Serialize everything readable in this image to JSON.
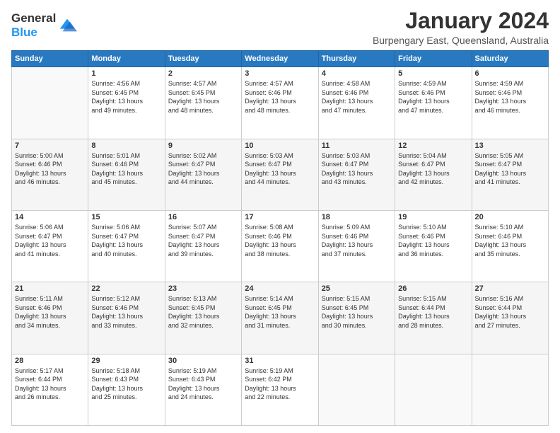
{
  "header": {
    "logo_general": "General",
    "logo_blue": "Blue",
    "month": "January 2024",
    "location": "Burpengary East, Queensland, Australia"
  },
  "weekdays": [
    "Sunday",
    "Monday",
    "Tuesday",
    "Wednesday",
    "Thursday",
    "Friday",
    "Saturday"
  ],
  "weeks": [
    [
      {
        "day": "",
        "sunrise": "",
        "sunset": "",
        "daylight": ""
      },
      {
        "day": "1",
        "sunrise": "Sunrise: 4:56 AM",
        "sunset": "Sunset: 6:45 PM",
        "daylight": "Daylight: 13 hours and 49 minutes."
      },
      {
        "day": "2",
        "sunrise": "Sunrise: 4:57 AM",
        "sunset": "Sunset: 6:45 PM",
        "daylight": "Daylight: 13 hours and 48 minutes."
      },
      {
        "day": "3",
        "sunrise": "Sunrise: 4:57 AM",
        "sunset": "Sunset: 6:46 PM",
        "daylight": "Daylight: 13 hours and 48 minutes."
      },
      {
        "day": "4",
        "sunrise": "Sunrise: 4:58 AM",
        "sunset": "Sunset: 6:46 PM",
        "daylight": "Daylight: 13 hours and 47 minutes."
      },
      {
        "day": "5",
        "sunrise": "Sunrise: 4:59 AM",
        "sunset": "Sunset: 6:46 PM",
        "daylight": "Daylight: 13 hours and 47 minutes."
      },
      {
        "day": "6",
        "sunrise": "Sunrise: 4:59 AM",
        "sunset": "Sunset: 6:46 PM",
        "daylight": "Daylight: 13 hours and 46 minutes."
      }
    ],
    [
      {
        "day": "7",
        "sunrise": "Sunrise: 5:00 AM",
        "sunset": "Sunset: 6:46 PM",
        "daylight": "Daylight: 13 hours and 46 minutes."
      },
      {
        "day": "8",
        "sunrise": "Sunrise: 5:01 AM",
        "sunset": "Sunset: 6:46 PM",
        "daylight": "Daylight: 13 hours and 45 minutes."
      },
      {
        "day": "9",
        "sunrise": "Sunrise: 5:02 AM",
        "sunset": "Sunset: 6:47 PM",
        "daylight": "Daylight: 13 hours and 44 minutes."
      },
      {
        "day": "10",
        "sunrise": "Sunrise: 5:03 AM",
        "sunset": "Sunset: 6:47 PM",
        "daylight": "Daylight: 13 hours and 44 minutes."
      },
      {
        "day": "11",
        "sunrise": "Sunrise: 5:03 AM",
        "sunset": "Sunset: 6:47 PM",
        "daylight": "Daylight: 13 hours and 43 minutes."
      },
      {
        "day": "12",
        "sunrise": "Sunrise: 5:04 AM",
        "sunset": "Sunset: 6:47 PM",
        "daylight": "Daylight: 13 hours and 42 minutes."
      },
      {
        "day": "13",
        "sunrise": "Sunrise: 5:05 AM",
        "sunset": "Sunset: 6:47 PM",
        "daylight": "Daylight: 13 hours and 41 minutes."
      }
    ],
    [
      {
        "day": "14",
        "sunrise": "Sunrise: 5:06 AM",
        "sunset": "Sunset: 6:47 PM",
        "daylight": "Daylight: 13 hours and 41 minutes."
      },
      {
        "day": "15",
        "sunrise": "Sunrise: 5:06 AM",
        "sunset": "Sunset: 6:47 PM",
        "daylight": "Daylight: 13 hours and 40 minutes."
      },
      {
        "day": "16",
        "sunrise": "Sunrise: 5:07 AM",
        "sunset": "Sunset: 6:47 PM",
        "daylight": "Daylight: 13 hours and 39 minutes."
      },
      {
        "day": "17",
        "sunrise": "Sunrise: 5:08 AM",
        "sunset": "Sunset: 6:46 PM",
        "daylight": "Daylight: 13 hours and 38 minutes."
      },
      {
        "day": "18",
        "sunrise": "Sunrise: 5:09 AM",
        "sunset": "Sunset: 6:46 PM",
        "daylight": "Daylight: 13 hours and 37 minutes."
      },
      {
        "day": "19",
        "sunrise": "Sunrise: 5:10 AM",
        "sunset": "Sunset: 6:46 PM",
        "daylight": "Daylight: 13 hours and 36 minutes."
      },
      {
        "day": "20",
        "sunrise": "Sunrise: 5:10 AM",
        "sunset": "Sunset: 6:46 PM",
        "daylight": "Daylight: 13 hours and 35 minutes."
      }
    ],
    [
      {
        "day": "21",
        "sunrise": "Sunrise: 5:11 AM",
        "sunset": "Sunset: 6:46 PM",
        "daylight": "Daylight: 13 hours and 34 minutes."
      },
      {
        "day": "22",
        "sunrise": "Sunrise: 5:12 AM",
        "sunset": "Sunset: 6:46 PM",
        "daylight": "Daylight: 13 hours and 33 minutes."
      },
      {
        "day": "23",
        "sunrise": "Sunrise: 5:13 AM",
        "sunset": "Sunset: 6:45 PM",
        "daylight": "Daylight: 13 hours and 32 minutes."
      },
      {
        "day": "24",
        "sunrise": "Sunrise: 5:14 AM",
        "sunset": "Sunset: 6:45 PM",
        "daylight": "Daylight: 13 hours and 31 minutes."
      },
      {
        "day": "25",
        "sunrise": "Sunrise: 5:15 AM",
        "sunset": "Sunset: 6:45 PM",
        "daylight": "Daylight: 13 hours and 30 minutes."
      },
      {
        "day": "26",
        "sunrise": "Sunrise: 5:15 AM",
        "sunset": "Sunset: 6:44 PM",
        "daylight": "Daylight: 13 hours and 28 minutes."
      },
      {
        "day": "27",
        "sunrise": "Sunrise: 5:16 AM",
        "sunset": "Sunset: 6:44 PM",
        "daylight": "Daylight: 13 hours and 27 minutes."
      }
    ],
    [
      {
        "day": "28",
        "sunrise": "Sunrise: 5:17 AM",
        "sunset": "Sunset: 6:44 PM",
        "daylight": "Daylight: 13 hours and 26 minutes."
      },
      {
        "day": "29",
        "sunrise": "Sunrise: 5:18 AM",
        "sunset": "Sunset: 6:43 PM",
        "daylight": "Daylight: 13 hours and 25 minutes."
      },
      {
        "day": "30",
        "sunrise": "Sunrise: 5:19 AM",
        "sunset": "Sunset: 6:43 PM",
        "daylight": "Daylight: 13 hours and 24 minutes."
      },
      {
        "day": "31",
        "sunrise": "Sunrise: 5:19 AM",
        "sunset": "Sunset: 6:42 PM",
        "daylight": "Daylight: 13 hours and 22 minutes."
      },
      {
        "day": "",
        "sunrise": "",
        "sunset": "",
        "daylight": ""
      },
      {
        "day": "",
        "sunrise": "",
        "sunset": "",
        "daylight": ""
      },
      {
        "day": "",
        "sunrise": "",
        "sunset": "",
        "daylight": ""
      }
    ]
  ]
}
